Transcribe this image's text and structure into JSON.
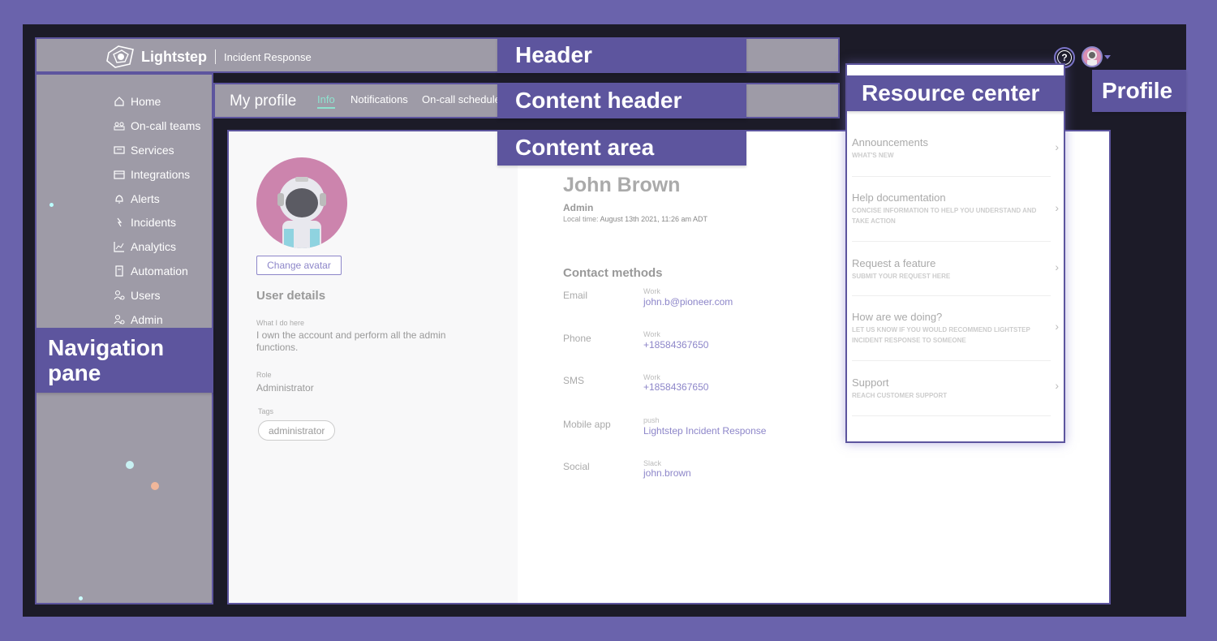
{
  "header": {
    "logo_name": "Lightstep",
    "product": "Incident Response",
    "help_glyph": "?",
    "help_icon": "question-circle-icon",
    "profile_icon": "astronaut-avatar-icon"
  },
  "nav": {
    "items": [
      {
        "label": "Home",
        "icon": "home-icon"
      },
      {
        "label": "On-call teams",
        "icon": "team-icon"
      },
      {
        "label": "Services",
        "icon": "services-icon"
      },
      {
        "label": "Integrations",
        "icon": "integrations-icon"
      },
      {
        "label": "Alerts",
        "icon": "bell-icon"
      },
      {
        "label": "Incidents",
        "icon": "incident-icon"
      },
      {
        "label": "Analytics",
        "icon": "chart-icon"
      },
      {
        "label": "Automation",
        "icon": "automation-icon"
      },
      {
        "label": "Users",
        "icon": "users-icon"
      },
      {
        "label": "Admin",
        "icon": "admin-icon"
      }
    ]
  },
  "content_header": {
    "title": "My profile",
    "tabs": [
      {
        "label": "Info",
        "active": true
      },
      {
        "label": "Notifications",
        "active": false
      },
      {
        "label": "On-call schedule",
        "active": false
      }
    ]
  },
  "profile": {
    "change_avatar": "Change avatar",
    "user_details_title": "User details",
    "what_i_do_label": "What I do here",
    "what_i_do_value": "I own the account and perform all the admin functions.",
    "role_label": "Role",
    "role_value": "Administrator",
    "tags_label": "Tags",
    "tags": [
      "administrator"
    ],
    "name": "John Brown",
    "role": "Admin",
    "local_time_label": "Local time:",
    "local_time_value": "August 13th 2021, 11:26 am ADT",
    "contact_methods_title": "Contact methods",
    "contacts": [
      {
        "label": "Email",
        "type": "Work",
        "value": "john.b@pioneer.com"
      },
      {
        "label": "Phone",
        "type": "Work",
        "value": "+18584367650"
      },
      {
        "label": "SMS",
        "type": "Work",
        "value": "+18584367650"
      },
      {
        "label": "Mobile app",
        "type": "push",
        "value": "Lightstep Incident Response"
      },
      {
        "label": "Social",
        "type": "Slack",
        "value": "john.brown"
      }
    ]
  },
  "resource_center": {
    "items": [
      {
        "title": "Announcements",
        "subtitle": "WHAT'S NEW"
      },
      {
        "title": "Help documentation",
        "subtitle": "CONCISE INFORMATION TO HELP YOU UNDERSTAND AND TAKE ACTION"
      },
      {
        "title": "Request a feature",
        "subtitle": "SUBMIT YOUR REQUEST HERE"
      },
      {
        "title": "How are we doing?",
        "subtitle": "LET US KNOW IF YOU WOULD RECOMMEND LIGHTSTEP INCIDENT RESPONSE TO SOMEONE"
      },
      {
        "title": "Support",
        "subtitle": "REACH CUSTOMER SUPPORT"
      }
    ],
    "chevron": "›"
  },
  "labels": {
    "header": "Header",
    "content_header": "Content header",
    "content_area": "Content area",
    "resource_center": "Resource center",
    "profile": "Profile",
    "navigation_pane": "Navigation pane"
  },
  "colors": {
    "background": "#6a63ac",
    "label_bg": "#5d559e",
    "app_dark": "#1c1b28",
    "overlay_gray": "#9e9ba7",
    "accent_teal": "#8ee3cf",
    "link": "#8d86c9"
  }
}
